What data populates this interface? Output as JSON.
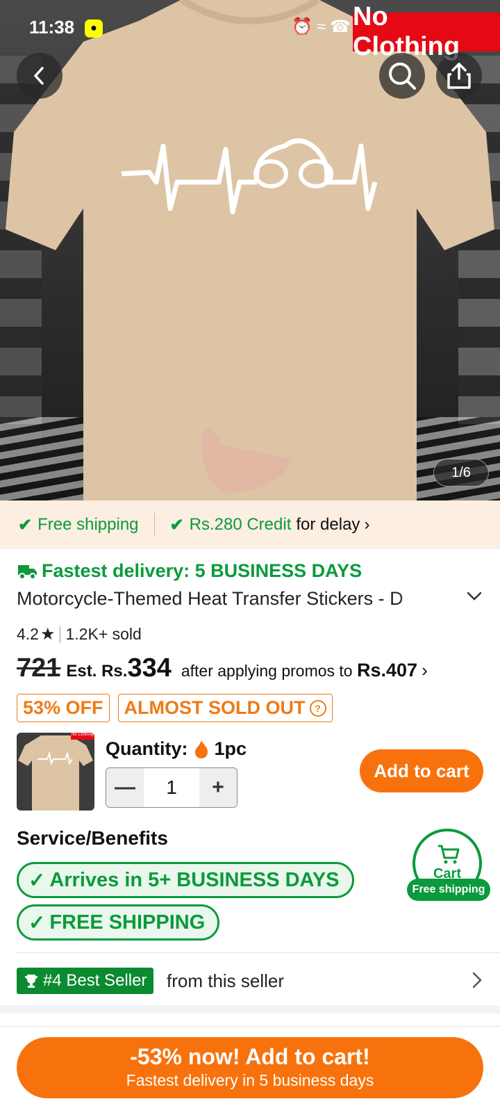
{
  "status_bar": {
    "time": "11:38",
    "watermark": "No Clothing"
  },
  "gallery": {
    "counter": "1/6"
  },
  "shipping_strip": {
    "free_shipping": "Free shipping",
    "credit_amount": "Rs.280 Credit",
    "credit_suffix": "for delay"
  },
  "delivery": {
    "headline": "Fastest delivery: 5 BUSINESS DAYS"
  },
  "product": {
    "title": "Motorcycle-Themed Heat Transfer Stickers - D",
    "rating": "4.2",
    "sold": "1.2K+ sold",
    "original_price": "721",
    "est_label": "Est. Rs.",
    "est_price": "334",
    "promo_text": "after applying promos to",
    "promo_price": "Rs.407",
    "discount_badge": "53% OFF",
    "stock_badge": "ALMOST SOLD OUT"
  },
  "quantity": {
    "label": "Quantity:",
    "note": "1pc",
    "value": "1",
    "add_to_cart": "Add to cart",
    "thumb_tag": "No Clothing"
  },
  "services": {
    "title": "Service/Benefits",
    "pill_arrives": "Arrives in 5+ BUSINESS DAYS",
    "pill_free": "FREE SHIPPING"
  },
  "cart_float": {
    "label": "Cart",
    "tag": "Free shipping"
  },
  "seller": {
    "badge": "#4 Best Seller",
    "text": "from this seller"
  },
  "cta": {
    "line1": "-53% now! Add to cart!",
    "line2": "Fastest delivery in 5 business days"
  },
  "colors": {
    "accent": "#f7720d",
    "green": "#0b9a3c",
    "shirt": "#dcc4a4"
  }
}
